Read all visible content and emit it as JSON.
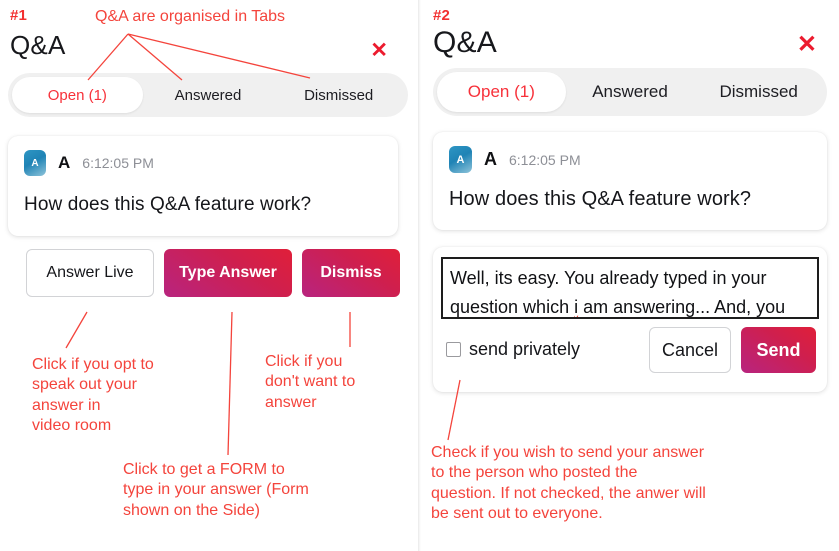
{
  "panels": [
    {
      "step": "#1",
      "title": "Q&A",
      "close_icon": "✕",
      "tabs": [
        {
          "label": "Open (1)",
          "active": true
        },
        {
          "label": "Answered",
          "active": false
        },
        {
          "label": "Dismissed",
          "active": false
        }
      ],
      "question": {
        "avatar_initial": "A",
        "author": "A",
        "time": "6:12:05 PM",
        "text": "How does this Q&A feature work?"
      },
      "actions": [
        {
          "label": "Answer Live",
          "style": "outline"
        },
        {
          "label": "Type Answer",
          "style": "gradient"
        },
        {
          "label": "Dismiss",
          "style": "gradient"
        }
      ],
      "annotations": {
        "tabs_note": "Q&A are organised in Tabs",
        "answer_live_note": "Click if you opt to\nspeak out your\nanswer in\nvideo room",
        "dismiss_note": "Click if you\ndon't want to\nanswer",
        "type_answer_note": "Click to get a FORM to\ntype in your answer (Form\nshown on the Side)"
      }
    },
    {
      "step": "#2",
      "title": "Q&A",
      "close_icon": "✕",
      "tabs": [
        {
          "label": "Open (1)",
          "active": true
        },
        {
          "label": "Answered",
          "active": false
        },
        {
          "label": "Dismissed",
          "active": false
        }
      ],
      "question": {
        "avatar_initial": "A",
        "author": "A",
        "time": "6:12:05 PM",
        "text": "How does this Q&A feature work?"
      },
      "answer_form": {
        "value_line_1": "Well, its easy. You already typed in your",
        "value_line_2_a": "question which ",
        "value_line_2_typo": "i",
        "value_line_2_b": " am answering... And, you",
        "checkbox_label": "send privately",
        "checkbox_checked": false,
        "cancel_label": "Cancel",
        "send_label": "Send"
      },
      "annotations": {
        "privacy_note": "Check if you wish to send your answer\nto the person who posted the\nquestion. If not checked, the anwer will\nbe sent out to everyone."
      }
    }
  ],
  "colors": {
    "annotation_red": "#f4443c",
    "step_red": "#f23030",
    "active_tab_red": "#f7313a",
    "close_red": "#ec1b2e",
    "gradient_from": "#e01f39",
    "gradient_to": "#b8247f",
    "avatar_blue": "#2e96c4"
  }
}
